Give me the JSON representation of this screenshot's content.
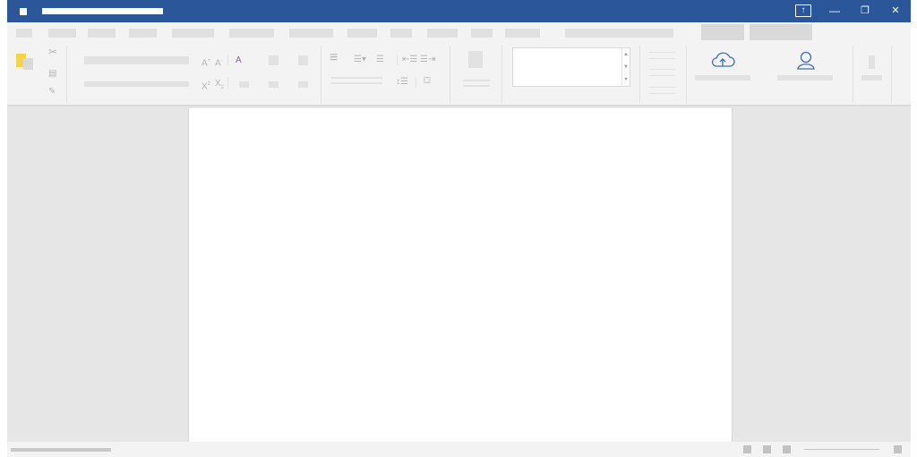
{
  "window_controls": {
    "share_icon": "share-upload-icon",
    "share_glyph": "↑",
    "minimize_glyph": "—",
    "restore_glyph": "❐",
    "close_glyph": "✕"
  },
  "ribbon": {
    "font_group": {
      "grow_label": "A",
      "shrink_label": "A",
      "clear_format_label": "A",
      "superscript_label": "X",
      "superscript_mark": "2",
      "subscript_label": "X",
      "subscript_mark": "2"
    },
    "share_icons": [
      "cloud-upload-icon",
      "person-icon"
    ]
  },
  "colors": {
    "titlebar": "#2b579a",
    "ribbon_bg": "#f3f3f3",
    "canvas_bg": "#e6e6e6",
    "paste_accent": "#f5d34a",
    "icon_blue": "#3b6fb6"
  }
}
